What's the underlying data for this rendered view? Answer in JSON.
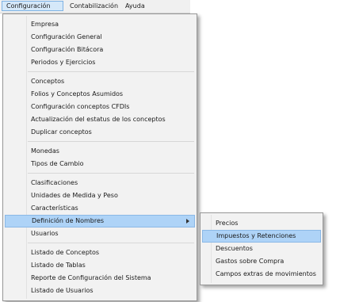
{
  "menubar": {
    "configuracion": "Configuración",
    "contabilizacion": "Contabilización",
    "ayuda": "Ayuda"
  },
  "config_menu": {
    "items": [
      "Empresa",
      "Configuración General",
      "Configuración Bitácora",
      "Periodos y Ejercicios",
      "Conceptos",
      "Folios y Conceptos Asumidos",
      "Configuración conceptos CFDIs",
      "Actualización del estatus de los conceptos",
      "Duplicar conceptos",
      "Monedas",
      "Tipos de Cambio",
      "Clasificaciones",
      "Unidades de Medida y Peso",
      "Características",
      "Definición de Nombres",
      "Usuarios",
      "Listado de Conceptos",
      "Listado de Tablas",
      "Reporte de Configuración del Sistema",
      "Listado de Usuarios"
    ]
  },
  "submenu": {
    "items": [
      "Precios",
      "Impuestos y Retenciones",
      "Descuentos",
      "Gastos sobre Compra",
      "Campos extras de movimientos"
    ]
  },
  "colors": {
    "menu_bg": "#f2f2f2",
    "highlight": "#aed3f7",
    "menubar_active": "#d5e8f9"
  }
}
